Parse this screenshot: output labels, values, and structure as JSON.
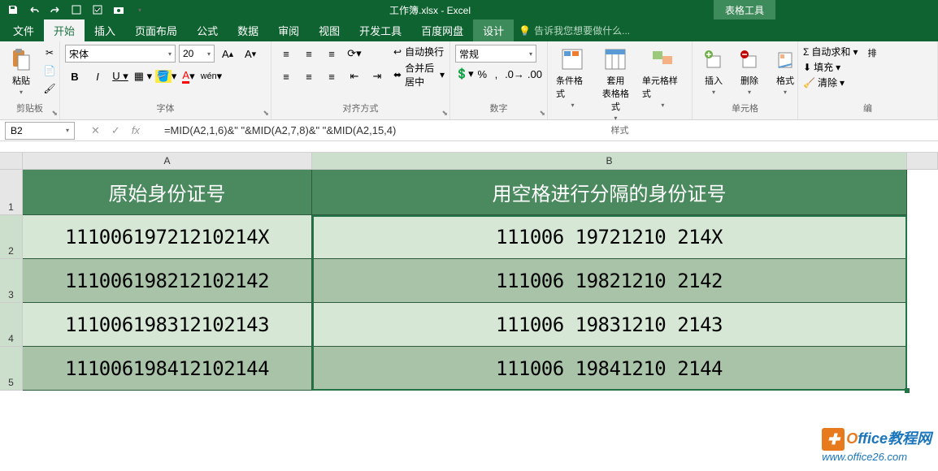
{
  "title": "工作簿.xlsx - Excel",
  "context_tab": "表格工具",
  "menu": {
    "file": "文件",
    "home": "开始",
    "insert": "插入",
    "layout": "页面布局",
    "formulas": "公式",
    "data": "数据",
    "review": "审阅",
    "view": "视图",
    "dev": "开发工具",
    "baidu": "百度网盘",
    "design": "设计",
    "tellme": "告诉我您想要做什么..."
  },
  "ribbon": {
    "paste": "粘贴",
    "clipboard": "剪贴板",
    "font_name": "宋体",
    "font_size": "20",
    "font_group": "字体",
    "align_group": "对齐方式",
    "wrap": "自动换行",
    "merge": "合并后居中",
    "number_format": "常规",
    "number_group": "数字",
    "cond_fmt": "条件格式",
    "table_fmt": "套用\n表格格式",
    "cell_style": "单元格样式",
    "styles_group": "样式",
    "insert_btn": "插入",
    "delete_btn": "删除",
    "format_btn": "格式",
    "cells_group": "单元格",
    "autosum": "自动求和",
    "fill": "填充",
    "clear": "清除",
    "sort": "排",
    "edit_group": "编"
  },
  "name_box": "B2",
  "formula": "=MID(A2,1,6)&\" \"&MID(A2,7,8)&\" \"&MID(A2,15,4)",
  "columns": {
    "a": "A",
    "b": "B"
  },
  "header": {
    "col_a": "原始身份证号",
    "col_b": "用空格进行分隔的身份证号"
  },
  "rows": [
    {
      "a": "11100619721210214X",
      "b": "111006 19721210 214X"
    },
    {
      "a": "111006198212102142",
      "b": "111006 19821210 2142"
    },
    {
      "a": "111006198312102143",
      "b": "111006 19831210 2143"
    },
    {
      "a": "111006198412102144",
      "b": "111006 19841210 2144"
    }
  ],
  "watermark": {
    "brand_o": "O",
    "brand_rest": "ffice教程网",
    "url": "www.office26.com"
  }
}
